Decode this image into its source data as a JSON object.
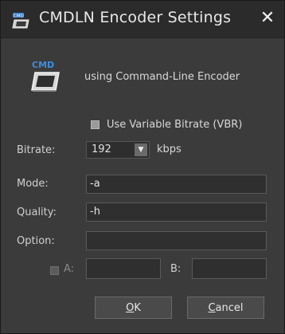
{
  "window": {
    "title": "CMDLN Encoder Settings",
    "close_glyph": "✕",
    "title_icon": "cmd-encoder-icon"
  },
  "header": {
    "app_icon": "cmd-encoder-icon",
    "app_icon_text": "CMD",
    "description": "using Command-Line Encoder"
  },
  "vbr": {
    "label": "Use Variable Bitrate (VBR)",
    "checked": false
  },
  "bitrate": {
    "label": "Bitrate:",
    "value": "192",
    "unit": "kbps",
    "dropdown_glyph": "▼"
  },
  "mode": {
    "label": "Mode:",
    "value": "-a"
  },
  "quality": {
    "label": "Quality:",
    "value": "-h"
  },
  "option": {
    "label": "Option:",
    "value": ""
  },
  "ab": {
    "a_label": "A:",
    "a_checked": false,
    "a_enabled": false,
    "a_value": "",
    "b_label": "B:",
    "b_value": ""
  },
  "buttons": {
    "ok_mnemonic": "O",
    "ok_rest": "K",
    "cancel_mnemonic": "C",
    "cancel_rest": "ancel"
  },
  "colors": {
    "background": "#3b3b3b",
    "titlebar": "#2b2b2b",
    "input_bg": "#2f2f2f",
    "text": "#dcdcdc"
  }
}
